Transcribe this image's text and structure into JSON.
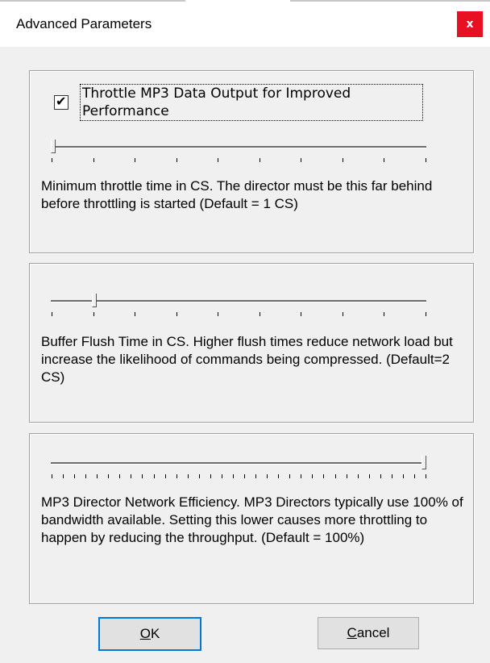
{
  "window": {
    "title": "Advanced Parameters",
    "close_label": "x"
  },
  "throttle": {
    "checkbox_checked": true,
    "checkbox_mark": "✔",
    "checkbox_label": "Throttle MP3 Data Output for Improved Performance",
    "slider_value": 1,
    "slider_min": 1,
    "slider_max": 10,
    "description": "Minimum throttle time in CS. The director must be this far behind before throttling is started (Default = 1 CS)"
  },
  "buffer": {
    "slider_value": 2,
    "slider_min": 1,
    "slider_max": 10,
    "description": "Buffer Flush Time in CS.  Higher flush times reduce network load but increase the likelihood of commands being compressed.  (Default=2 CS)"
  },
  "efficiency": {
    "slider_value": 100,
    "slider_min": 0,
    "slider_max": 100,
    "description": "MP3 Director Network Efficiency.  MP3 Directors typically use 100% of bandwidth available. Setting this lower causes more throttling to happen by reducing the throughput.  (Default = 100%)"
  },
  "buttons": {
    "ok_label": "OK",
    "ok_mnemonic": "O",
    "ok_rest": "K",
    "cancel_label": "Cancel",
    "cancel_mnemonic": "C",
    "cancel_rest": "ancel"
  },
  "colors": {
    "close_bg": "#e81123",
    "focus_border": "#0078d7",
    "window_bg": "#f0f0f0"
  }
}
